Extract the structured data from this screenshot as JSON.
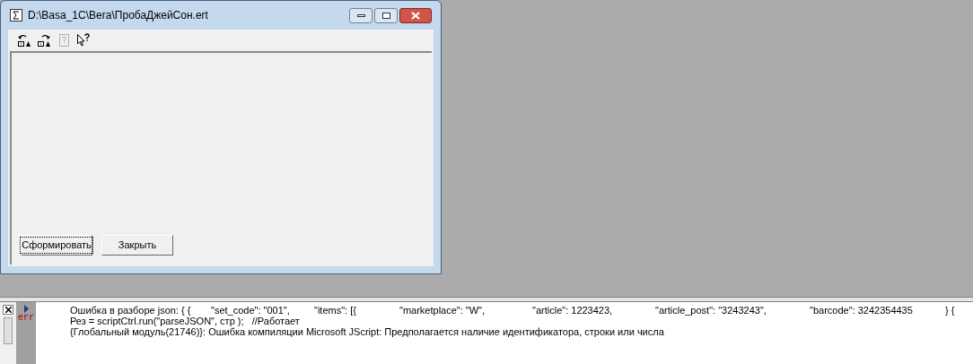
{
  "window": {
    "title": "D:\\Basa_1C\\Вега\\ПробаДжейСон.ert"
  },
  "toolbar": [
    {
      "kind": "undo",
      "disabled": false
    },
    {
      "kind": "redo",
      "disabled": false
    },
    {
      "kind": "help",
      "disabled": true
    },
    {
      "kind": "whatsthis",
      "disabled": false
    }
  ],
  "buttons": [
    {
      "label": "Сформировать",
      "focused": true
    },
    {
      "label": "Закрыть",
      "focused": false
    }
  ],
  "messages": {
    "gutter_label": "err",
    "first_line": [
      "Ошибка в разборе json: { {",
      "\"set_code\": \"001\",",
      "\"items\": [{",
      "\"marketplace\": \"W\",",
      "\"article\": 1223423,",
      "\"article_post\": \"3243243\",",
      "\"barcode\": 3242354435",
      "} {"
    ],
    "lines": [
      "Рез = scriptCtrl.run(\"parseJSON\", стр );   //Работает",
      "{Глобальный модуль(21746)}: Ошибка компиляции Microsoft JScript: Предполагается наличие идентификатора, строки или числа"
    ]
  }
}
